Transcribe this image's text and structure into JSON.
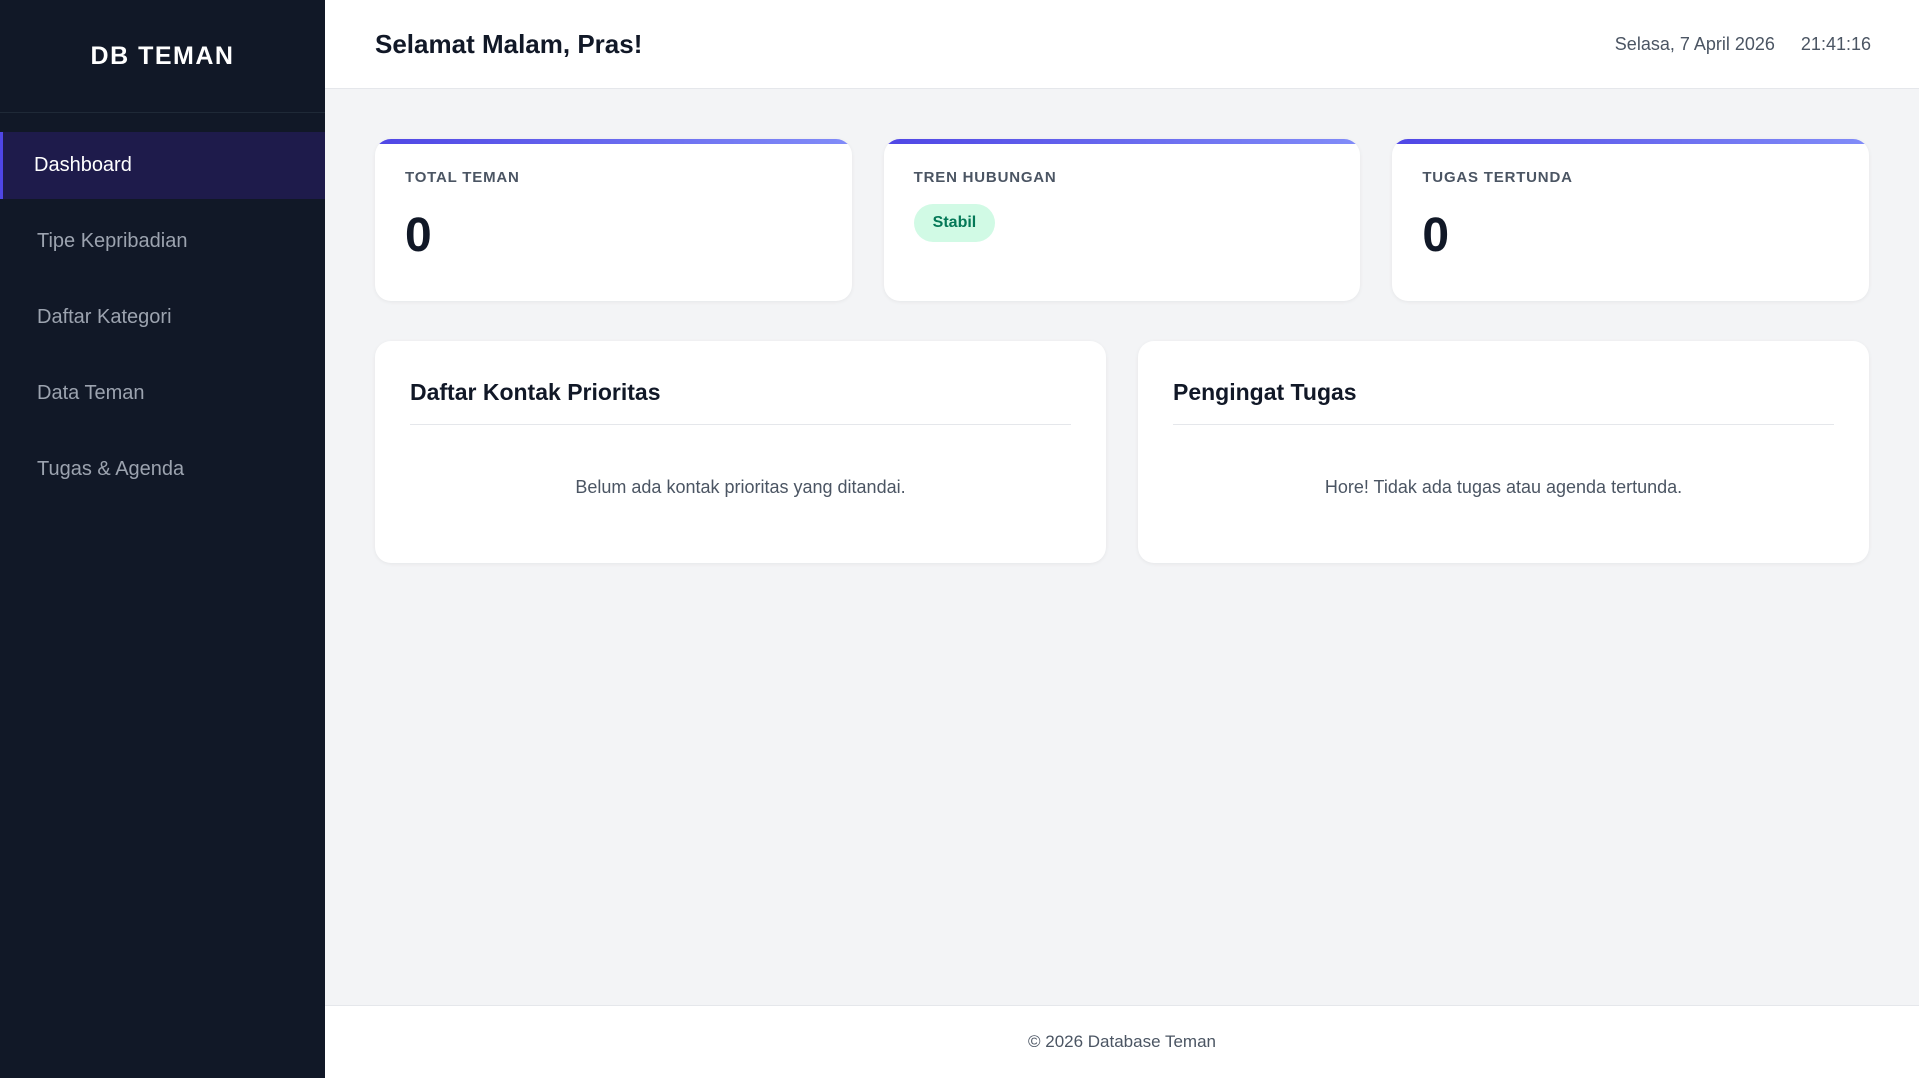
{
  "app": {
    "brand": "DB TEMAN"
  },
  "sidebar": {
    "items": [
      {
        "label": "Dashboard",
        "active": true
      },
      {
        "label": "Tipe Kepribadian",
        "active": false
      },
      {
        "label": "Daftar Kategori",
        "active": false
      },
      {
        "label": "Data Teman",
        "active": false
      },
      {
        "label": "Tugas & Agenda",
        "active": false
      }
    ]
  },
  "header": {
    "greeting": "Selamat Malam, Pras!",
    "date": "Selasa, 7 April 2026",
    "time": "21:41:16"
  },
  "stats": [
    {
      "label": "TOTAL TEMAN",
      "value": "0"
    },
    {
      "label": "TREN HUBUNGAN",
      "badge": "Stabil"
    },
    {
      "label": "TUGAS TERTUNDA",
      "value": "0"
    }
  ],
  "panels": {
    "priority": {
      "title": "Daftar Kontak Prioritas",
      "empty": "Belum ada kontak prioritas yang ditandai."
    },
    "tasks": {
      "title": "Pengingat Tugas",
      "empty": "Hore! Tidak ada tugas atau agenda tertunda."
    }
  },
  "footer": {
    "text": "© 2026 Database Teman"
  },
  "colors": {
    "sidebar_bg": "#111827",
    "accent": "#4f46e5",
    "badge_bg": "#d1fae5",
    "badge_text": "#047857"
  }
}
